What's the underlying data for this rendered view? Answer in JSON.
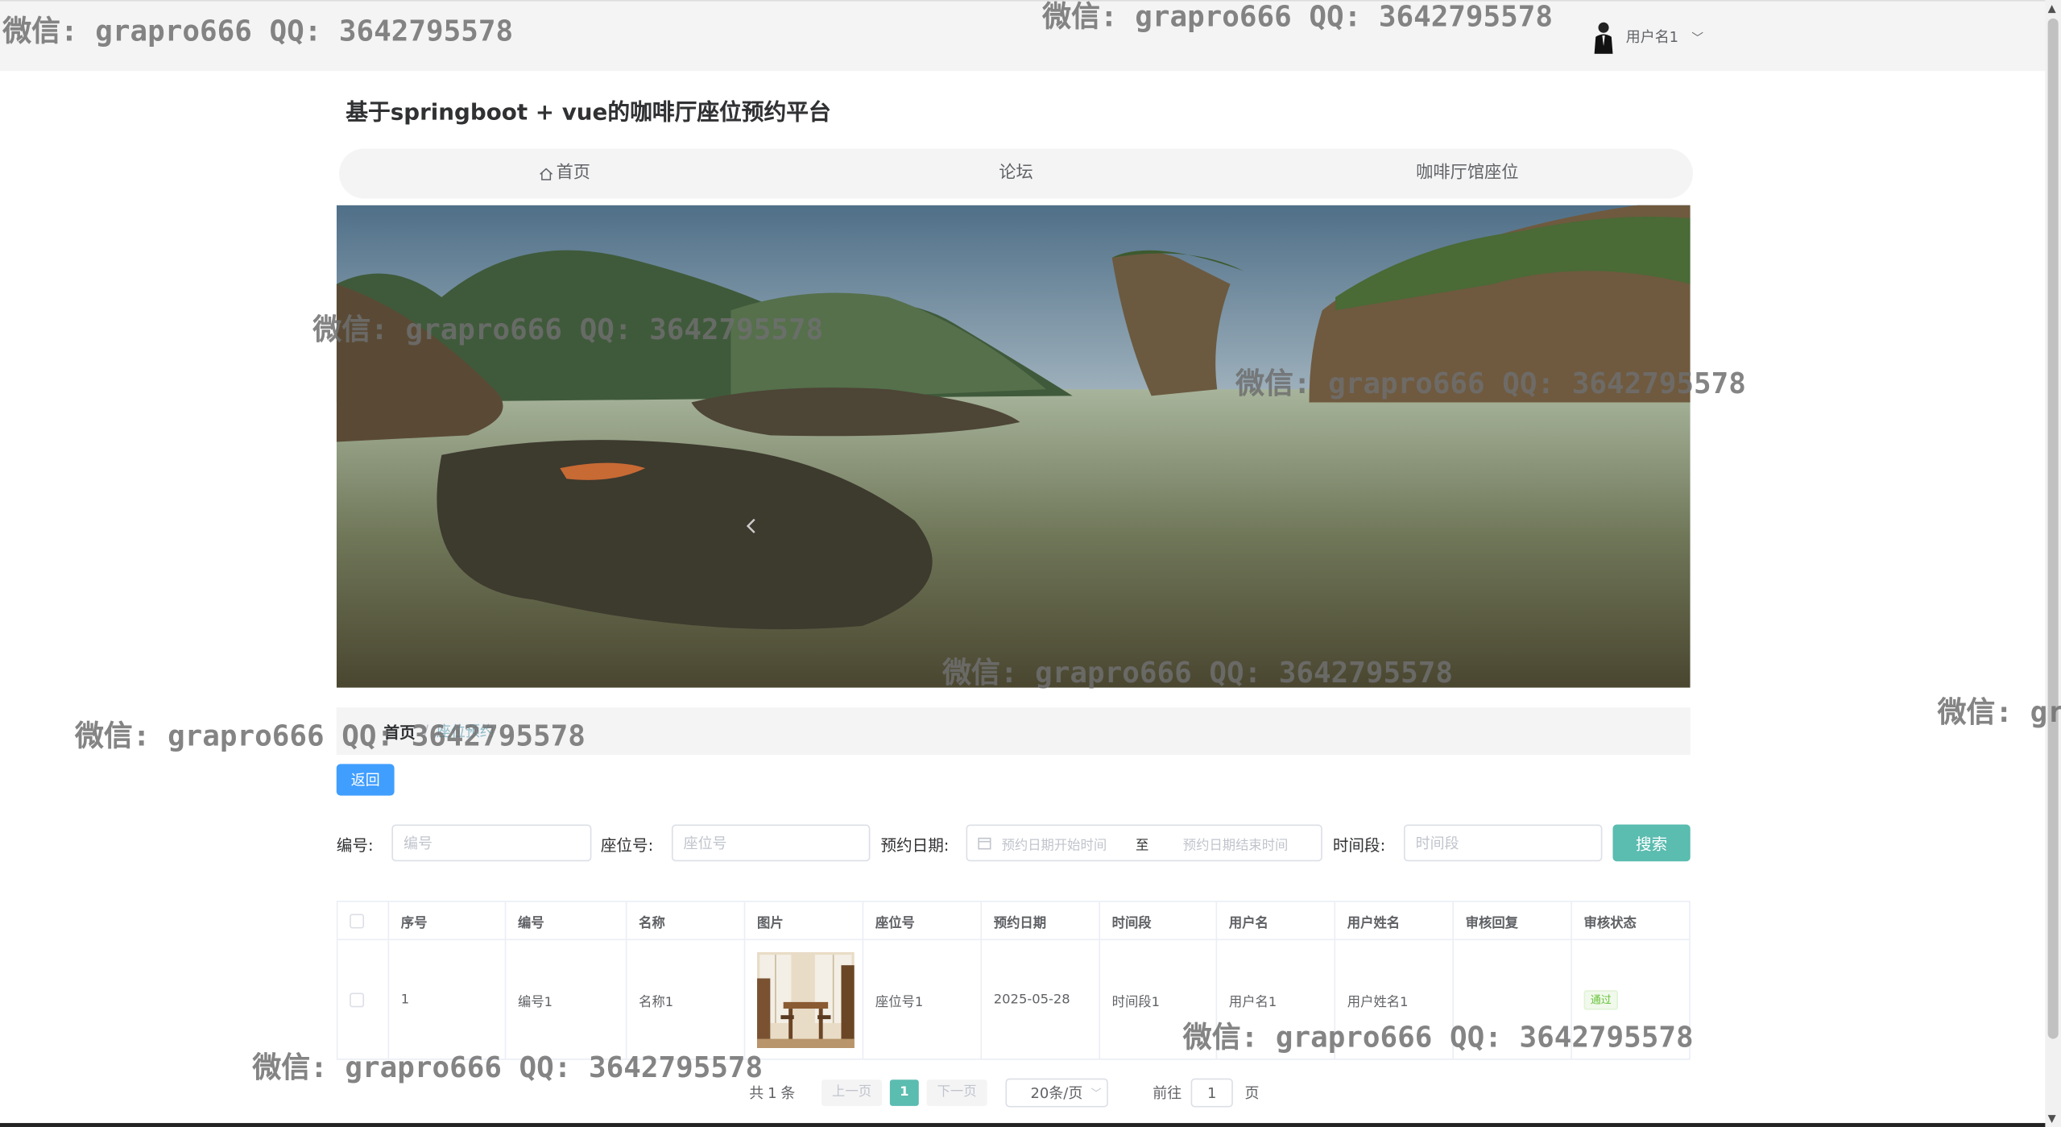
{
  "header": {
    "username": "用户名1"
  },
  "site": {
    "title": "基于springboot + vue的咖啡厅座位预约平台"
  },
  "nav": {
    "items": [
      "首页",
      "论坛",
      "咖啡厅馆座位"
    ]
  },
  "breadcrumb": {
    "home": "首页",
    "separator": "/",
    "current": "座位预约"
  },
  "actions": {
    "back": "返回",
    "search": "搜索"
  },
  "search": {
    "code_label": "编号:",
    "code_placeholder": "编号",
    "seat_label": "座位号:",
    "seat_placeholder": "座位号",
    "date_label": "预约日期:",
    "date_start_placeholder": "预约日期开始时间",
    "date_sep": "至",
    "date_end_placeholder": "预约日期结束时间",
    "slot_label": "时间段:",
    "slot_placeholder": "时间段"
  },
  "table": {
    "columns": [
      "序号",
      "编号",
      "名称",
      "图片",
      "座位号",
      "预约日期",
      "时间段",
      "用户名",
      "用户姓名",
      "审核回复",
      "审核状态"
    ],
    "rows": [
      {
        "index": "1",
        "code": "编号1",
        "name": "名称1",
        "seat": "座位号1",
        "date": "2025-05-28",
        "slot": "时间段1",
        "username": "用户名1",
        "realname": "用户姓名1",
        "reply": "",
        "status": "通过"
      }
    ]
  },
  "pagination": {
    "total_prefix": "共",
    "total": "1",
    "total_suffix": "条",
    "prev": "上一页",
    "current": "1",
    "next": "下一页",
    "page_size": "20条/页",
    "goto_label": "前往",
    "goto_value": "1",
    "goto_suffix": "页"
  },
  "watermark": "微信: grapro666 QQ: 3642795578",
  "colors": {
    "primary": "#409eff",
    "accent": "#5bbcb0",
    "success": "#67c23a"
  },
  "icons": {
    "home": "home-icon",
    "calendar": "calendar-icon",
    "chevron": "chevron-down-icon"
  }
}
